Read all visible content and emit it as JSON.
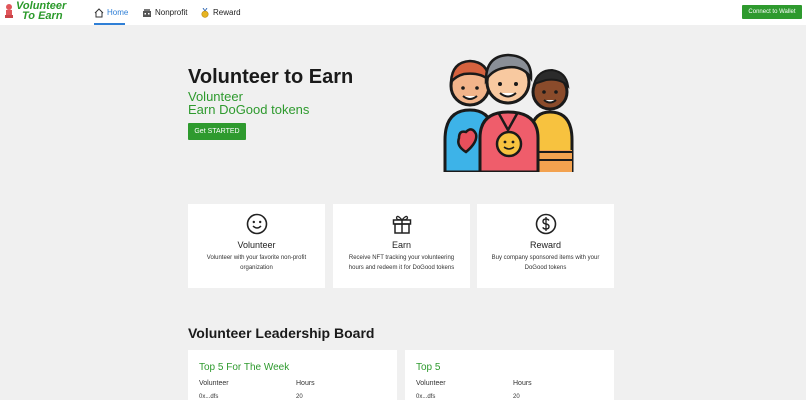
{
  "brand": {
    "line1": "Volunteer",
    "line2": "To Earn"
  },
  "nav": {
    "home": "Home",
    "nonprofit": "Nonprofit",
    "reward": "Reward",
    "wallet": "Connect to Wallet"
  },
  "hero": {
    "title": "Volunteer to Earn",
    "subtitle1": "Volunteer",
    "subtitle2": "Earn DoGood tokens",
    "cta": "Get STARTED"
  },
  "features": [
    {
      "title": "Volunteer",
      "desc": "Volunteer with your favorite non-profit organization",
      "icon": "smile-icon"
    },
    {
      "title": "Earn",
      "desc": "Receive NFT tracking your volunteering hours and redeem it for DoGood tokens",
      "icon": "gift-icon"
    },
    {
      "title": "Reward",
      "desc": "Buy company sponsored items with your DoGood tokens",
      "icon": "dollar-icon"
    }
  ],
  "leaderboard": {
    "title": "Volunteer Leadership Board",
    "panels": [
      {
        "title": "Top 5 For The Week",
        "col1": "Volunteer",
        "col2": "Hours",
        "row_volunteer": "0x...dfs",
        "row_hours": "20"
      },
      {
        "title": "Top 5",
        "col1": "Volunteer",
        "col2": "Hours",
        "row_volunteer": "0x...dfs",
        "row_hours": "20"
      }
    ]
  },
  "colors": {
    "accent": "#2e9a2e",
    "nav_active": "#2f7fd6",
    "background": "#f0f0f0"
  }
}
